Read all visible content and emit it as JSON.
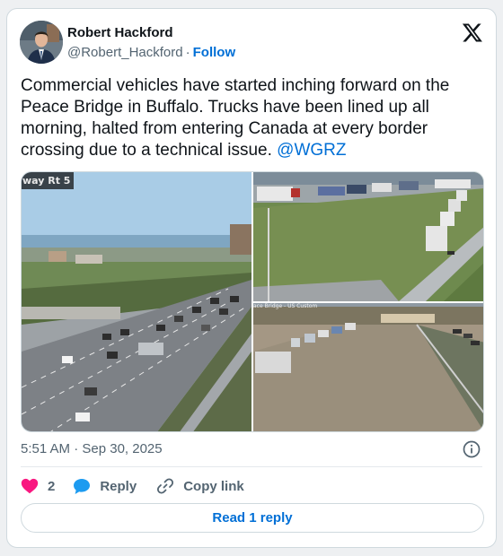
{
  "author": {
    "name": "Robert Hackford",
    "handle": "@Robert_Hackford",
    "separator": "·",
    "follow_label": "Follow"
  },
  "tweet": {
    "text": "Commercial vehicles have started inching forward on the Peace Bridge in Buffalo. Trucks have been lined up all morning, halted from entering Canada at every border crossing due to a technical issue.",
    "mention": "@WGRZ"
  },
  "media": {
    "main_overlay": "way Rt 5",
    "small_overlay": "ace Bridge - US Custom"
  },
  "meta": {
    "timestamp": "5:51 AM · Sep 30, 2025"
  },
  "actions": {
    "like_count": "2",
    "reply_label": "Reply",
    "copy_label": "Copy link"
  },
  "read_reply_label": "Read 1 reply",
  "colors": {
    "link": "#006fd6",
    "like": "#f91880",
    "reply_bubble": "#1d9bf0",
    "secondary_text": "#536471"
  },
  "icons": [
    "x-logo-icon",
    "info-icon",
    "heart-icon",
    "reply-bubble-icon",
    "link-icon"
  ]
}
